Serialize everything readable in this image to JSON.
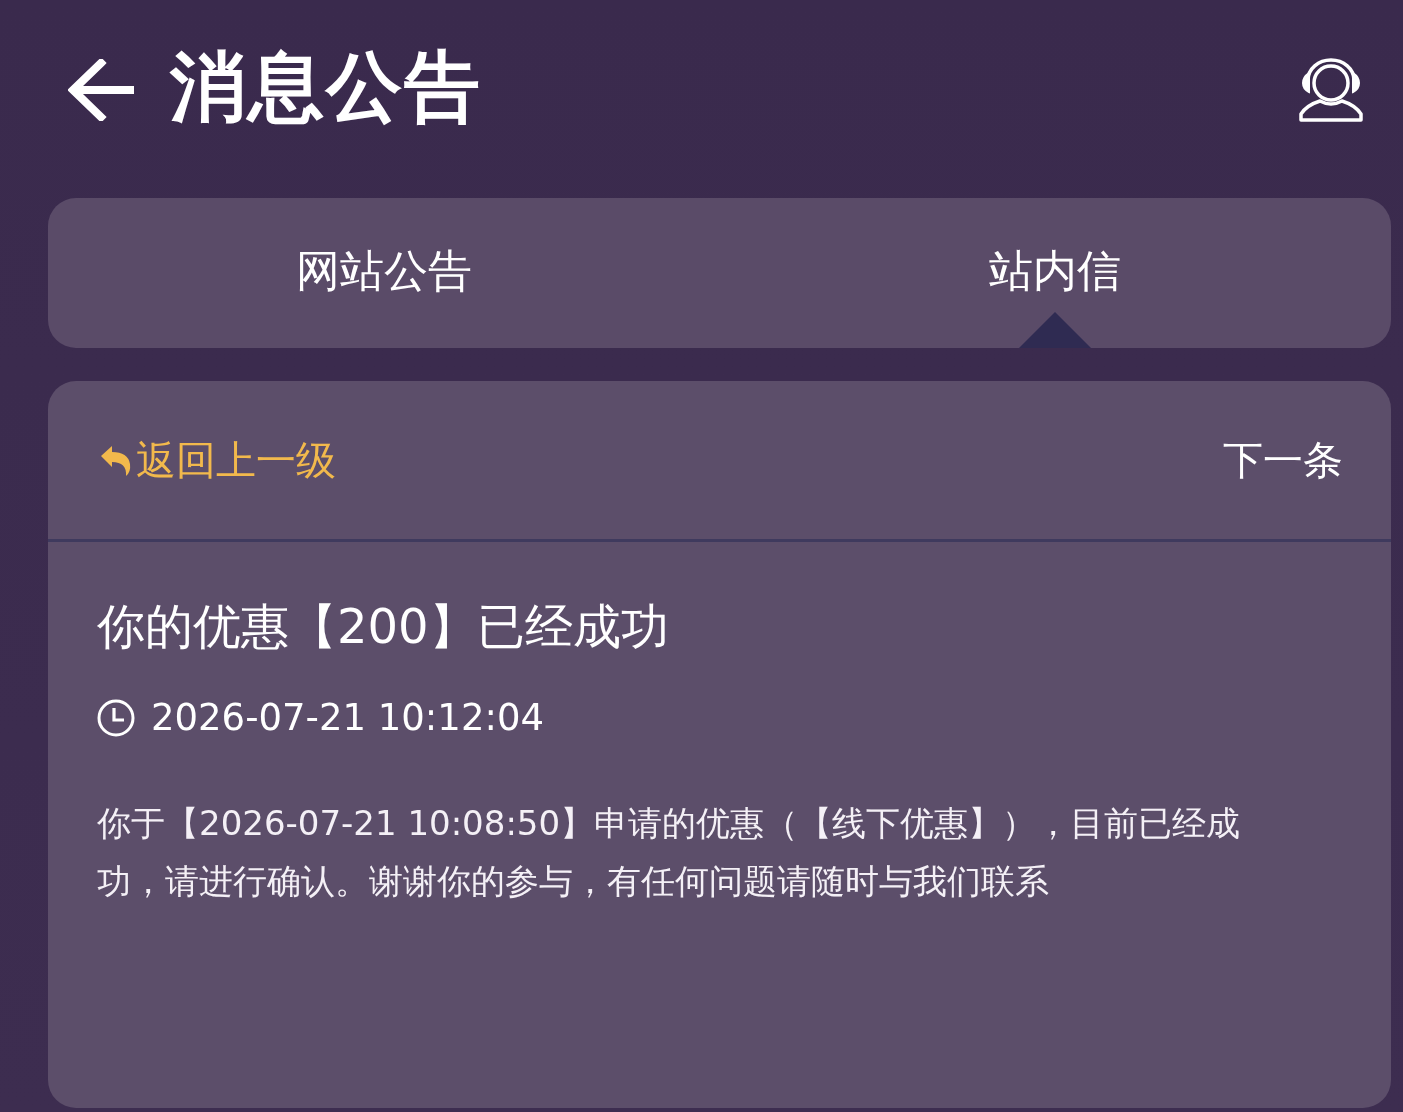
{
  "header": {
    "title": "消息公告"
  },
  "tabs": [
    {
      "label": "网站公告",
      "selected": false
    },
    {
      "label": "站内信",
      "selected": true
    }
  ],
  "message": {
    "back_link": "返回上一级",
    "next_link": "下一条",
    "title": "你的优惠【200】已经成功",
    "time": "2026-07-21 10:12:04",
    "body": "你于【2026-07-21 10:08:50】申请的优惠（【线下优惠】），目前已经成功，请进行确认。谢谢你的参与，有任何问题请随时与我们联系"
  }
}
